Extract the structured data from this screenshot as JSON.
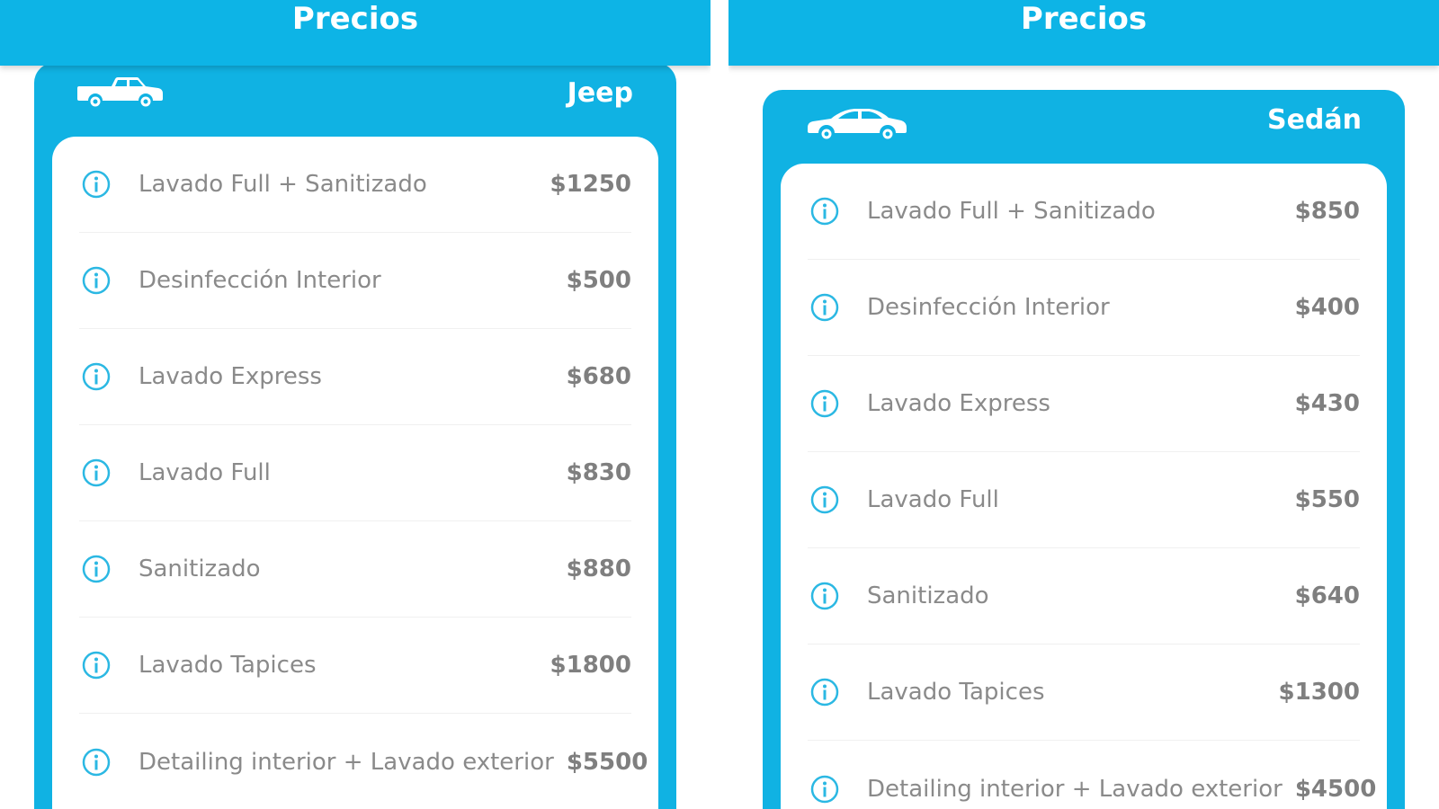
{
  "screens": [
    {
      "header_title": "Precios",
      "vehicle_label": "Jeep",
      "vehicle_icon": "pickup-icon",
      "items": [
        {
          "service": "Lavado Full + Sanitizado",
          "price": "$1250"
        },
        {
          "service": "Desinfección Interior",
          "price": "$500"
        },
        {
          "service": "Lavado Express",
          "price": "$680"
        },
        {
          "service": "Lavado Full",
          "price": "$830"
        },
        {
          "service": "Sanitizado",
          "price": "$880"
        },
        {
          "service": "Lavado Tapices",
          "price": "$1800"
        },
        {
          "service": "Detailing interior + Lavado exterior",
          "price": "$5500"
        }
      ]
    },
    {
      "header_title": "Precios",
      "vehicle_label": "Sedán",
      "vehicle_icon": "sedan-icon",
      "items": [
        {
          "service": "Lavado Full + Sanitizado",
          "price": "$850"
        },
        {
          "service": "Desinfección Interior",
          "price": "$400"
        },
        {
          "service": "Lavado Express",
          "price": "$430"
        },
        {
          "service": "Lavado Full",
          "price": "$550"
        },
        {
          "service": "Sanitizado",
          "price": "$640"
        },
        {
          "service": "Lavado Tapices",
          "price": "$1300"
        },
        {
          "service": "Detailing interior + Lavado exterior",
          "price": "$4500"
        }
      ]
    }
  ],
  "colors": {
    "accent": "#0db4e6",
    "card": "#10b2e3",
    "text": "#8a8a8a"
  }
}
